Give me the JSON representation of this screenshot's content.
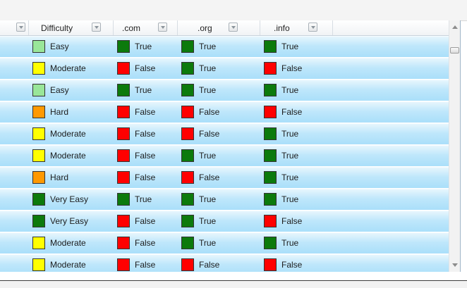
{
  "colors": {
    "Very Easy": "#0c7a0c",
    "Easy": "#99e699",
    "Moderate": "#ffff00",
    "Hard": "#ff9900",
    "True": "#0c7a0c",
    "False": "#ff0000"
  },
  "columns": [
    {
      "label": "",
      "filter_icon": "dropdown-filter-icon"
    },
    {
      "label": "Difficulty",
      "filter_icon": "dropdown-filter-icon"
    },
    {
      "label": ".com",
      "filter_icon": "dropdown-filter-icon"
    },
    {
      "label": ".org",
      "filter_icon": "dropdown-filter-icon"
    },
    {
      "label": ".info",
      "filter_icon": "dropdown-filter-icon"
    }
  ],
  "rows": [
    [
      "Easy",
      "True",
      "True",
      "True"
    ],
    [
      "Moderate",
      "False",
      "True",
      "False"
    ],
    [
      "Easy",
      "True",
      "True",
      "True"
    ],
    [
      "Hard",
      "False",
      "False",
      "False"
    ],
    [
      "Moderate",
      "False",
      "False",
      "True"
    ],
    [
      "Moderate",
      "False",
      "True",
      "True"
    ],
    [
      "Hard",
      "False",
      "False",
      "True"
    ],
    [
      "Very Easy",
      "True",
      "True",
      "True"
    ],
    [
      "Very Easy",
      "False",
      "True",
      "False"
    ],
    [
      "Moderate",
      "False",
      "True",
      "True"
    ],
    [
      "Moderate",
      "False",
      "False",
      "False"
    ]
  ]
}
